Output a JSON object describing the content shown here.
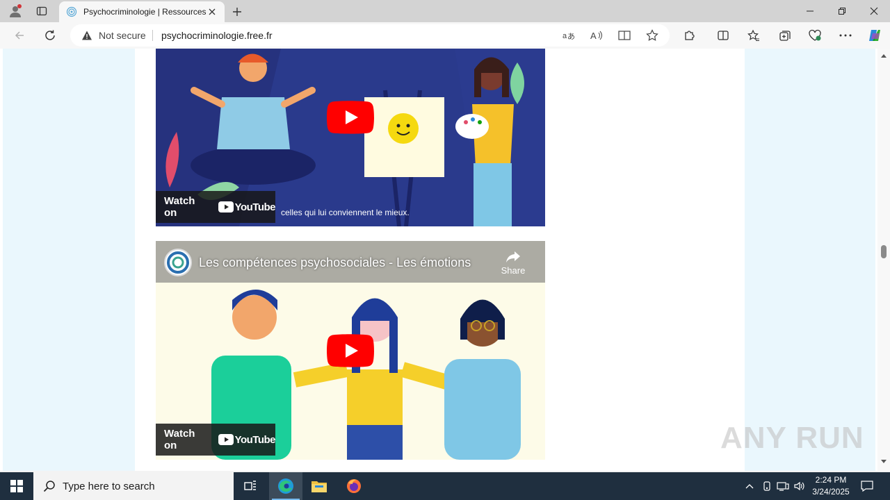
{
  "browser": {
    "tab_title": "Psychocriminologie | Ressources",
    "security_label": "Not secure",
    "url": "psychocriminologie.free.fr"
  },
  "videos": [
    {
      "watch_label": "Watch on",
      "youtube_label": "YouTube",
      "caption": "celles qui lui conviennent le mieux."
    },
    {
      "title": "Les compétences psychosociales - Les émotions",
      "share_label": "Share",
      "watch_label": "Watch on",
      "youtube_label": "YouTube"
    }
  ],
  "watermark": "ANY RUN",
  "taskbar": {
    "search_placeholder": "Type here to search",
    "time": "2:24 PM",
    "date": "3/24/2025"
  },
  "colors": {
    "side_panel": "#eaf7fd",
    "youtube_red": "#ff0000",
    "taskbar": "#1f2f3f"
  }
}
